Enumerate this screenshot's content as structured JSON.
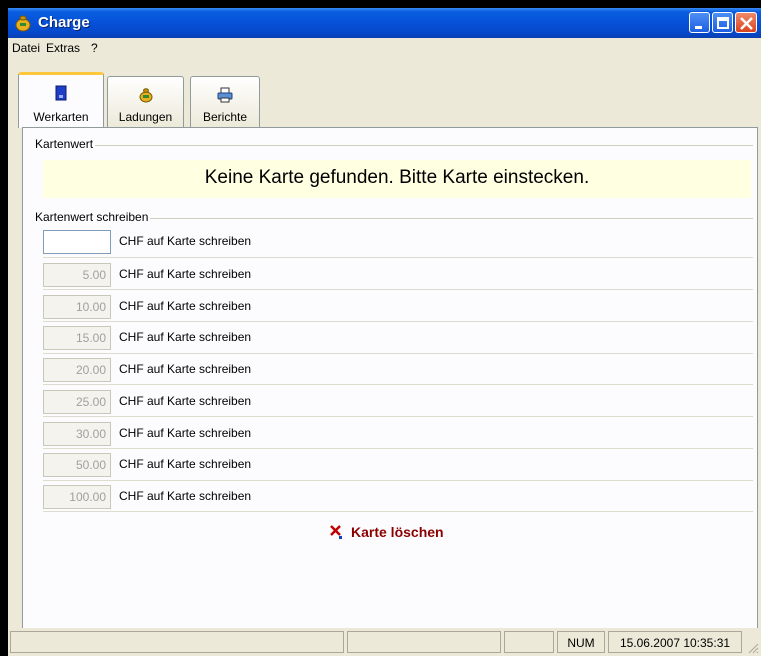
{
  "window": {
    "title": "Charge"
  },
  "menu": [
    "Datei",
    "Extras",
    "?"
  ],
  "tabs": [
    {
      "label": "Werkarten",
      "icon": "card-icon",
      "active": true
    },
    {
      "label": "Ladungen",
      "icon": "money-bag-icon",
      "active": false
    },
    {
      "label": "Berichte",
      "icon": "printer-icon",
      "active": false
    }
  ],
  "card_value": {
    "group_label": "Kartenwert",
    "message": "Keine Karte gefunden. Bitte Karte einstecken."
  },
  "write": {
    "group_label": "Kartenwert schreiben",
    "custom": {
      "value": "",
      "label": "CHF auf Karte schreiben"
    },
    "presets": [
      {
        "value": "5.00",
        "label": "CHF auf Karte schreiben"
      },
      {
        "value": "10.00",
        "label": "CHF auf Karte schreiben"
      },
      {
        "value": "15.00",
        "label": "CHF auf Karte schreiben"
      },
      {
        "value": "20.00",
        "label": "CHF auf Karte schreiben"
      },
      {
        "value": "25.00",
        "label": "CHF auf Karte schreiben"
      },
      {
        "value": "30.00",
        "label": "CHF auf Karte schreiben"
      },
      {
        "value": "50.00",
        "label": "CHF auf Karte schreiben"
      },
      {
        "value": "100.00",
        "label": "CHF auf Karte schreiben"
      }
    ]
  },
  "delete_label": "Karte löschen",
  "status": {
    "num": "NUM",
    "datetime": "15.06.2007 10:35:31"
  }
}
